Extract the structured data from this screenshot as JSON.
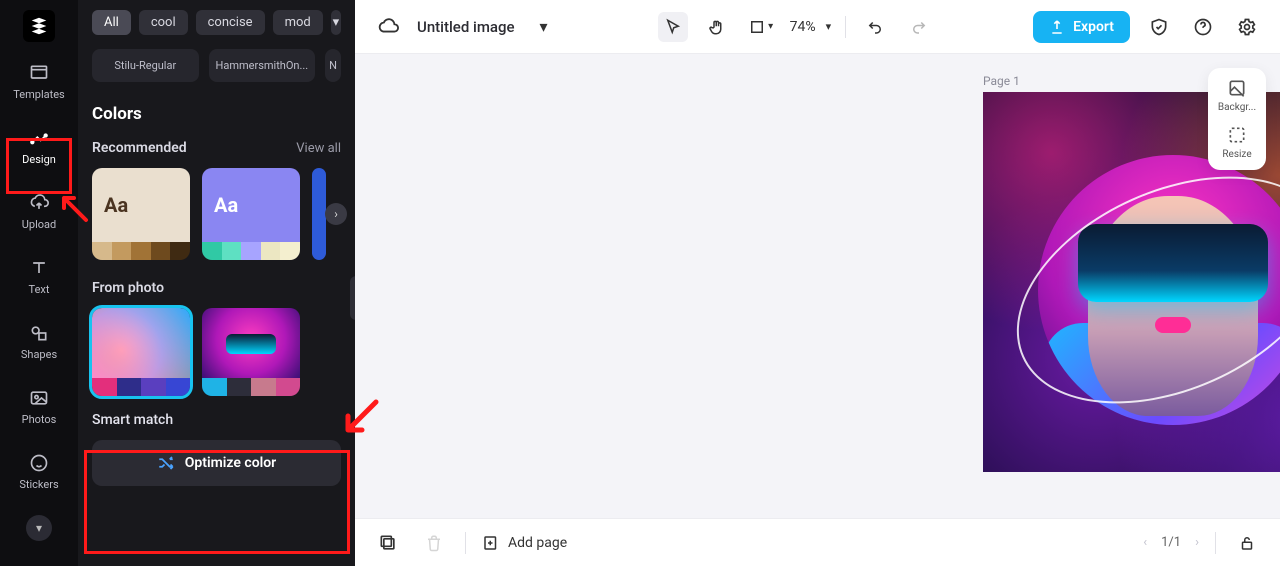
{
  "nav": {
    "templates": "Templates",
    "design": "Design",
    "upload": "Upload",
    "text": "Text",
    "shapes": "Shapes",
    "photos": "Photos",
    "stickers": "Stickers"
  },
  "chips": {
    "all": "All",
    "cool": "cool",
    "concise": "concise",
    "modern": "mod"
  },
  "fonts": {
    "card1": "Stilu-Regular",
    "card2": "HammersmithOn...",
    "card3": "N"
  },
  "colors": {
    "heading": "Colors",
    "recommended": "Recommended",
    "view_all": "View all",
    "aa": "Aa",
    "from_photo": "From photo",
    "smart_match": "Smart match",
    "optimize": "Optimize color"
  },
  "topbar": {
    "title": "Untitled image",
    "zoom": "74%",
    "export": "Export"
  },
  "canvas": {
    "page_label": "Page 1"
  },
  "side_tools": {
    "background": "Backgr...",
    "resize": "Resize"
  },
  "bottombar": {
    "add_page": "Add page",
    "pager": "1/1"
  },
  "palettes": {
    "rec1": {
      "bg": "#eadfcf",
      "fg": "#4b3421",
      "sw": [
        "#d6b98b",
        "#c39a5f",
        "#a17336",
        "#6e4a1e",
        "#3f2a12"
      ]
    },
    "rec2": {
      "bg": "#8a86f2",
      "fg": "#ffffff",
      "sw": [
        "#30c9a5",
        "#5ee0c2",
        "#a7a4ff",
        "#ece7c2",
        "#f4efcf"
      ]
    }
  },
  "photo_palettes": {
    "p1": {
      "sw": [
        "#e32f7c",
        "#2e2d8a",
        "#5a3fbf",
        "#3746d4"
      ]
    },
    "p2": {
      "sw": [
        "#1fb3e6",
        "#2d2d3a",
        "#c77a8d",
        "#d24a8f"
      ]
    }
  }
}
